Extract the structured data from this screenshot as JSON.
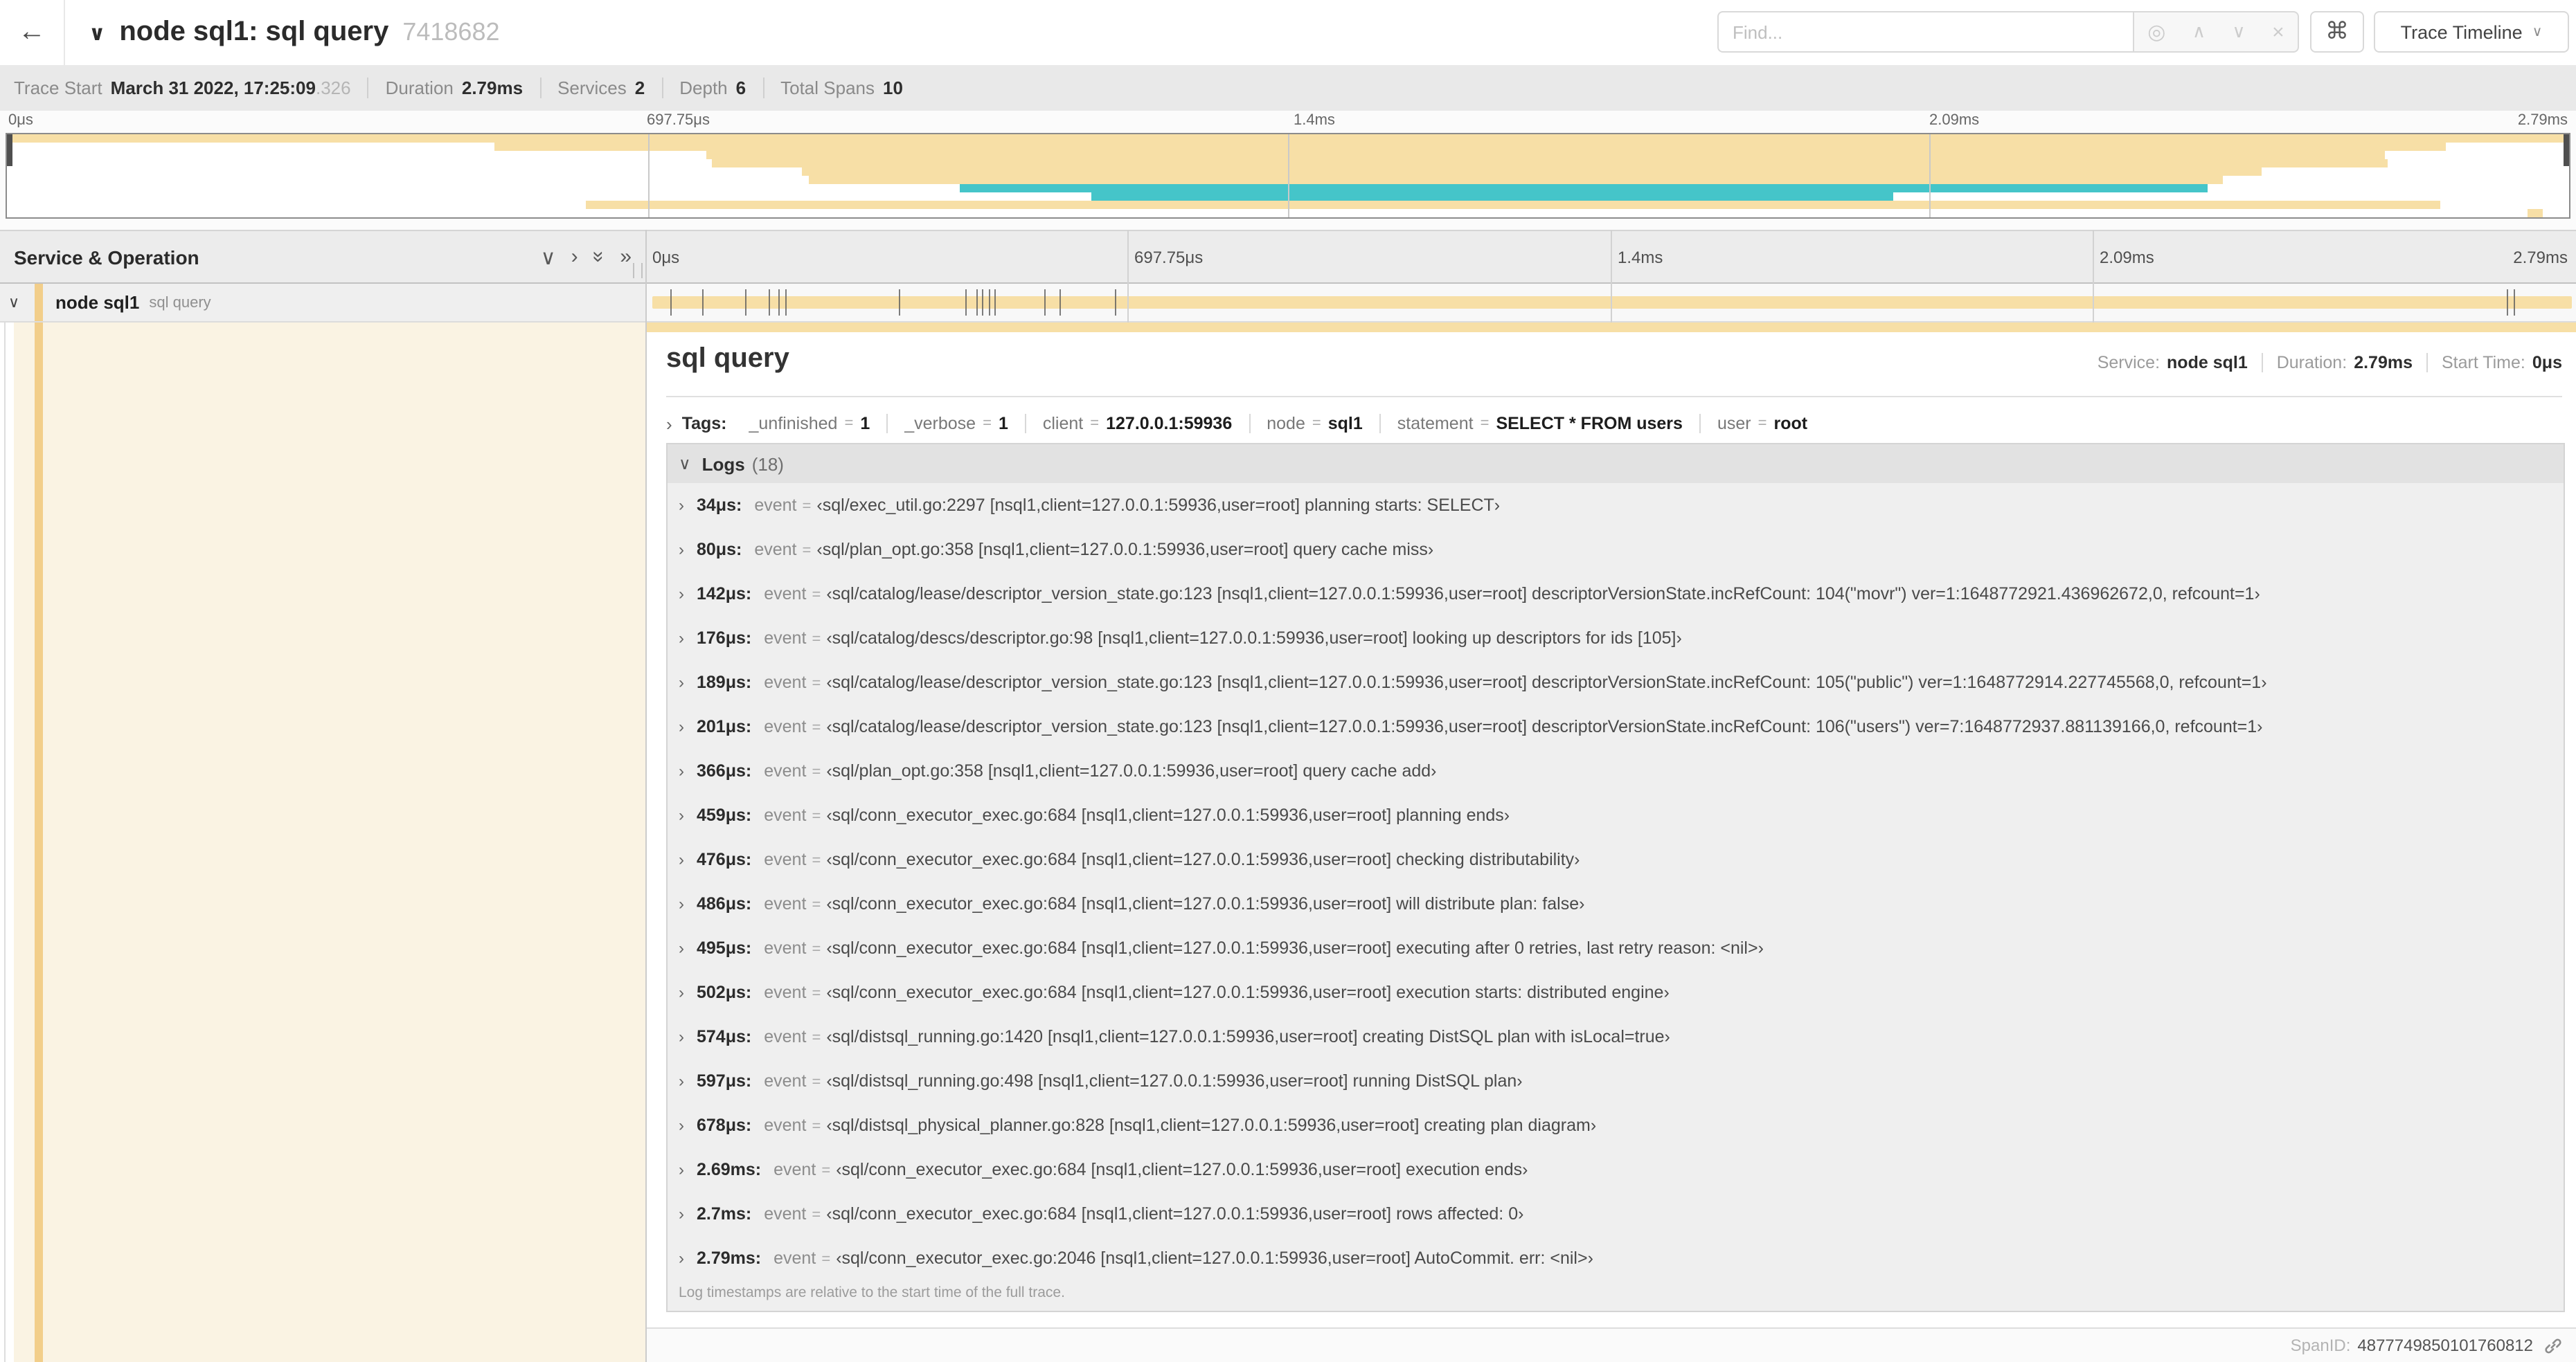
{
  "header": {
    "back_icon": "←",
    "collapse_icon": "∨",
    "title": "node sql1: sql query",
    "trace_id": "7418682",
    "find_placeholder": "Find...",
    "command_icon": "⌘",
    "view_selector": "Trace Timeline"
  },
  "summary": {
    "items": [
      {
        "label": "Trace Start",
        "value": "March 31 2022, 17:25:09",
        "suffix": ".326"
      },
      {
        "label": "Duration",
        "value": "2.79ms",
        "suffix": ""
      },
      {
        "label": "Services",
        "value": "2",
        "suffix": ""
      },
      {
        "label": "Depth",
        "value": "6",
        "suffix": ""
      },
      {
        "label": "Total Spans",
        "value": "10",
        "suffix": ""
      }
    ]
  },
  "minimap": {
    "ticks": [
      "0μs",
      "697.75μs",
      "1.4ms",
      "2.09ms",
      "2.79ms"
    ],
    "spans": [
      {
        "start": 0.0,
        "end": 100.0,
        "color": "tan"
      },
      {
        "start": 19.0,
        "end": 95.2,
        "color": "tan"
      },
      {
        "start": 27.3,
        "end": 92.8,
        "color": "tan"
      },
      {
        "start": 27.5,
        "end": 92.9,
        "color": "tan"
      },
      {
        "start": 31.0,
        "end": 88.0,
        "color": "tan"
      },
      {
        "start": 31.3,
        "end": 86.5,
        "color": "tan"
      },
      {
        "start": 37.2,
        "end": 85.9,
        "color": "cyan"
      },
      {
        "start": 42.3,
        "end": 73.6,
        "color": "cyan"
      },
      {
        "start": 22.6,
        "end": 95.0,
        "color": "tan"
      },
      {
        "start": 98.4,
        "end": 99.0,
        "color": "tan"
      }
    ]
  },
  "timeline": {
    "header": "Service & Operation",
    "ruler_ticks": [
      "0μs",
      "697.75μs",
      "1.4ms",
      "2.09ms",
      "2.79ms"
    ],
    "row": {
      "service": "node sql1",
      "operation": "sql query",
      "log_marks": [
        1.2,
        2.9,
        5.1,
        6.3,
        6.8,
        7.2,
        13.1,
        16.5,
        17.1,
        17.4,
        17.7,
        18.0,
        20.6,
        21.4,
        24.3,
        96.4,
        96.8
      ]
    }
  },
  "detail": {
    "title": "sql query",
    "service_label": "Service:",
    "service": "node sql1",
    "duration_label": "Duration:",
    "duration": "2.79ms",
    "start_label": "Start Time:",
    "start": "0μs",
    "tags_label": "Tags:",
    "tags": [
      {
        "key": "_unfinished",
        "value": "1"
      },
      {
        "key": "_verbose",
        "value": "1"
      },
      {
        "key": "client",
        "value": "127.0.0.1:59936"
      },
      {
        "key": "node",
        "value": "sql1"
      },
      {
        "key": "statement",
        "value": "SELECT * FROM users"
      },
      {
        "key": "user",
        "value": "root"
      }
    ],
    "logs_label": "Logs",
    "logs_count": "(18)",
    "logs": [
      {
        "time": "34μs",
        "key": "event",
        "value": "sql/exec_util.go:2297 [nsql1,client=127.0.0.1:59936,user=root] planning starts: SELECT"
      },
      {
        "time": "80μs",
        "key": "event",
        "value": "sql/plan_opt.go:358 [nsql1,client=127.0.0.1:59936,user=root] query cache miss"
      },
      {
        "time": "142μs",
        "key": "event",
        "value": "sql/catalog/lease/descriptor_version_state.go:123 [nsql1,client=127.0.0.1:59936,user=root] descriptorVersionState.incRefCount: 104(\"movr\") ver=1:1648772921.436962672,0, refcount=1"
      },
      {
        "time": "176μs",
        "key": "event",
        "value": "sql/catalog/descs/descriptor.go:98 [nsql1,client=127.0.0.1:59936,user=root] looking up descriptors for ids [105]"
      },
      {
        "time": "189μs",
        "key": "event",
        "value": "sql/catalog/lease/descriptor_version_state.go:123 [nsql1,client=127.0.0.1:59936,user=root] descriptorVersionState.incRefCount: 105(\"public\") ver=1:1648772914.227745568,0, refcount=1"
      },
      {
        "time": "201μs",
        "key": "event",
        "value": "sql/catalog/lease/descriptor_version_state.go:123 [nsql1,client=127.0.0.1:59936,user=root] descriptorVersionState.incRefCount: 106(\"users\") ver=7:1648772937.881139166,0, refcount=1"
      },
      {
        "time": "366μs",
        "key": "event",
        "value": "sql/plan_opt.go:358 [nsql1,client=127.0.0.1:59936,user=root] query cache add"
      },
      {
        "time": "459μs",
        "key": "event",
        "value": "sql/conn_executor_exec.go:684 [nsql1,client=127.0.0.1:59936,user=root] planning ends"
      },
      {
        "time": "476μs",
        "key": "event",
        "value": "sql/conn_executor_exec.go:684 [nsql1,client=127.0.0.1:59936,user=root] checking distributability"
      },
      {
        "time": "486μs",
        "key": "event",
        "value": "sql/conn_executor_exec.go:684 [nsql1,client=127.0.0.1:59936,user=root] will distribute plan: false"
      },
      {
        "time": "495μs",
        "key": "event",
        "value": "sql/conn_executor_exec.go:684 [nsql1,client=127.0.0.1:59936,user=root] executing after 0 retries, last retry reason: <nil>"
      },
      {
        "time": "502μs",
        "key": "event",
        "value": "sql/conn_executor_exec.go:684 [nsql1,client=127.0.0.1:59936,user=root] execution starts: distributed engine"
      },
      {
        "time": "574μs",
        "key": "event",
        "value": "sql/distsql_running.go:1420 [nsql1,client=127.0.0.1:59936,user=root] creating DistSQL plan with isLocal=true"
      },
      {
        "time": "597μs",
        "key": "event",
        "value": "sql/distsql_running.go:498 [nsql1,client=127.0.0.1:59936,user=root] running DistSQL plan"
      },
      {
        "time": "678μs",
        "key": "event",
        "value": "sql/distsql_physical_planner.go:828 [nsql1,client=127.0.0.1:59936,user=root] creating plan diagram"
      },
      {
        "time": "2.69ms",
        "key": "event",
        "value": "sql/conn_executor_exec.go:684 [nsql1,client=127.0.0.1:59936,user=root] execution ends"
      },
      {
        "time": "2.7ms",
        "key": "event",
        "value": "sql/conn_executor_exec.go:684 [nsql1,client=127.0.0.1:59936,user=root] rows affected: 0"
      },
      {
        "time": "2.79ms",
        "key": "event",
        "value": "sql/conn_executor_exec.go:2046 [nsql1,client=127.0.0.1:59936,user=root] AutoCommit. err: <nil>"
      }
    ],
    "logs_note": "Log timestamps are relative to the start time of the full trace.",
    "spanid_label": "SpanID:",
    "spanid": "4877749850101760812"
  },
  "colors": {
    "tan": "#f7dfa6",
    "cyan": "#45c5c9",
    "accent": "#f2ce8a",
    "cream": "#faf3e3"
  }
}
